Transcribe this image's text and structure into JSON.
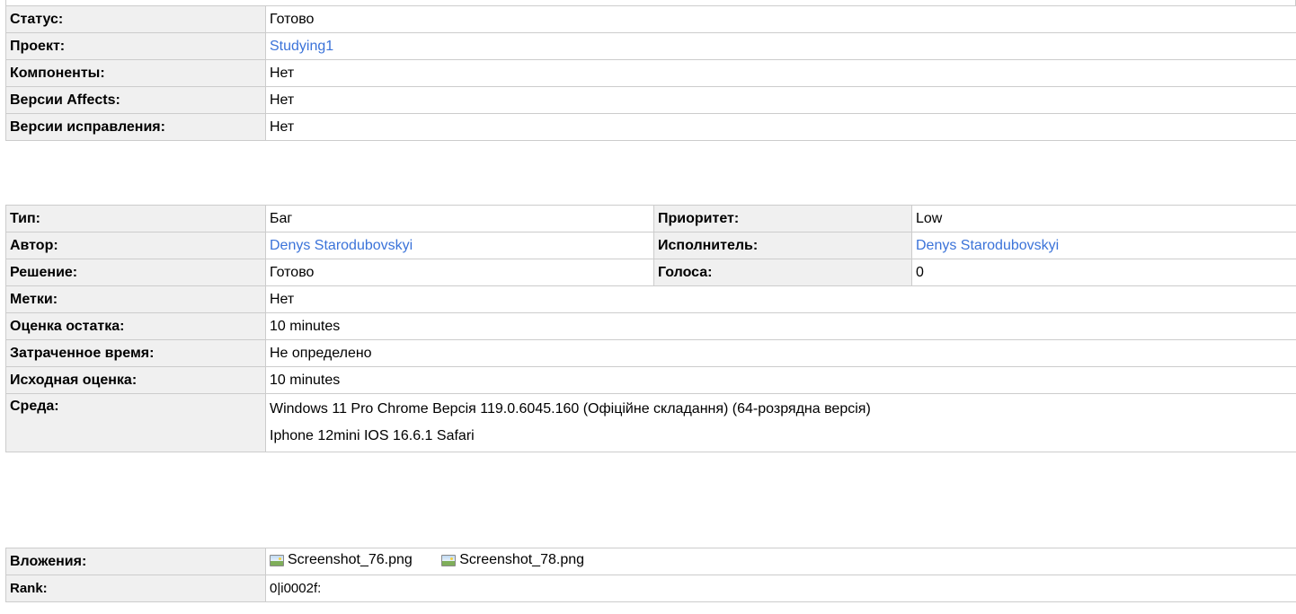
{
  "summary": {
    "rows": [
      {
        "label": "Статус:",
        "value": "Готово"
      },
      {
        "label": "Проект:",
        "value": "Studying1"
      },
      {
        "label": "Компоненты:",
        "value": "Нет"
      },
      {
        "label": "Версии Affects:",
        "value": "Нет"
      },
      {
        "label": "Версии исправления:",
        "value": "Нет"
      }
    ]
  },
  "details": {
    "type_label": "Тип:",
    "type_value": "Баг",
    "priority_label": "Приоритет:",
    "priority_value": "Low",
    "author_label": "Автор:",
    "author_value": "Denys Starodubovskyi",
    "assignee_label": "Исполнитель:",
    "assignee_value": "Denys Starodubovskyi",
    "resolution_label": "Решение:",
    "resolution_value": "Готово",
    "votes_label": "Голоса:",
    "votes_value": "0",
    "labels_label": "Метки:",
    "labels_value": "Нет",
    "remaining_label": "Оценка остатка:",
    "remaining_value": "10 minutes",
    "spent_label": "Затраченное время:",
    "spent_value": "Не определено",
    "original_label": "Исходная оценка:",
    "original_value": "10 minutes",
    "env_label": "Среда:",
    "env_lines": [
      "Windows 11 Pro Chrome Версія 119.0.6045.160 (Офіційне складання) (64-розрядна версія)",
      "Iphone 12mini IOS 16.6.1 Safari"
    ]
  },
  "extra": {
    "attachments_label": "Вложения:",
    "attachments": [
      "Screenshot_76.png",
      "Screenshot_78.png"
    ],
    "rank_label": "Rank:",
    "rank_value": "0|i0002f:"
  },
  "colors": {
    "link": "#3b73d9",
    "label_bg": "#f0f0f0",
    "border": "#cccccc"
  },
  "icons": {
    "attachment": "image-file-icon"
  }
}
